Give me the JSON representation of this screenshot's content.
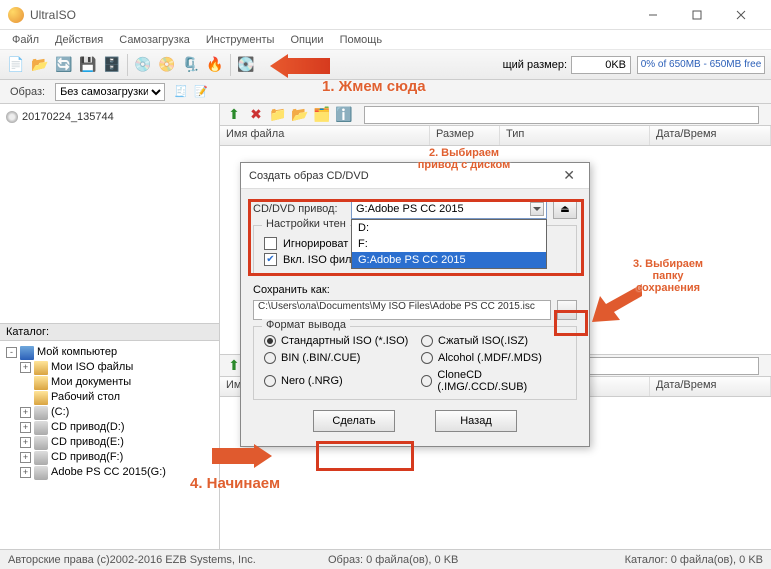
{
  "title": "UltraISO",
  "menu": [
    "Файл",
    "Действия",
    "Самозагрузка",
    "Инструменты",
    "Опции",
    "Помощь"
  ],
  "size_label": "щий размер:",
  "size_value": "0KB",
  "capacity": "0% of 650MB - 650MB free",
  "sub_image": "Образ:",
  "boot_mode": "Без самозагрузки",
  "tree_root": "20170224_135744",
  "catalog_label": "Каталог:",
  "local_tree": [
    {
      "exp": "-",
      "icon": "comp",
      "label": "Мой компьютер",
      "indent": 0
    },
    {
      "exp": "+",
      "icon": "fold",
      "label": "Мои ISO файлы",
      "indent": 1
    },
    {
      "exp": "",
      "icon": "fold",
      "label": "Мои документы",
      "indent": 1
    },
    {
      "exp": "",
      "icon": "fold",
      "label": "Рабочий стол",
      "indent": 1
    },
    {
      "exp": "+",
      "icon": "drv",
      "label": "(C:)",
      "indent": 1
    },
    {
      "exp": "+",
      "icon": "drv",
      "label": "CD привод(D:)",
      "indent": 1
    },
    {
      "exp": "+",
      "icon": "drv",
      "label": "CD привод(E:)",
      "indent": 1
    },
    {
      "exp": "+",
      "icon": "drv",
      "label": "CD привод(F:)",
      "indent": 1
    },
    {
      "exp": "+",
      "icon": "drv",
      "label": "Adobe PS CC 2015(G:)",
      "indent": 1
    }
  ],
  "cols": {
    "name": "Имя файла",
    "size": "Размер",
    "type": "Тип",
    "date": "Дата/Время"
  },
  "status": {
    "copyright": "Авторские права (c)2002-2016 EZB Systems, Inc.",
    "image": "Образ: 0 файла(ов), 0 KB",
    "local": "Каталог: 0 файла(ов), 0 KB"
  },
  "dialog": {
    "title": "Создать образ CD/DVD",
    "drive_label": "CD/DVD привод:",
    "drive_value": "G:Adobe PS CC 2015",
    "drop_opts": [
      "D:",
      "F:",
      "G:Adobe PS CC 2015"
    ],
    "read_group": "Настройки чтен",
    "chk_ignore": "Игнорироват",
    "chk_iso": "Вкл. ISO фильтр",
    "save_as": "Сохранить как:",
    "save_path": "C:\\Users\\ола\\Documents\\My ISO Files\\Adobe PS CC 2015.isc",
    "format_group": "Формат вывода",
    "radios": [
      "Стандартный ISO (*.ISO)",
      "Сжатый ISO(.ISZ)",
      "BIN (.BIN/.CUE)",
      "Alcohol (.MDF/.MDS)",
      "Nero (.NRG)",
      "CloneCD (.IMG/.CCD/.SUB)"
    ],
    "btn_make": "Сделать",
    "btn_back": "Назад"
  },
  "anno": {
    "a1": "1. Жмем сюда",
    "a2_l1": "2. Выбираем",
    "a2_l2": "привод с диском",
    "a3_l1": "3. Выбираем",
    "a3_l2": "папку",
    "a3_l3": "сохранения",
    "a4": "4. Начинаем"
  }
}
